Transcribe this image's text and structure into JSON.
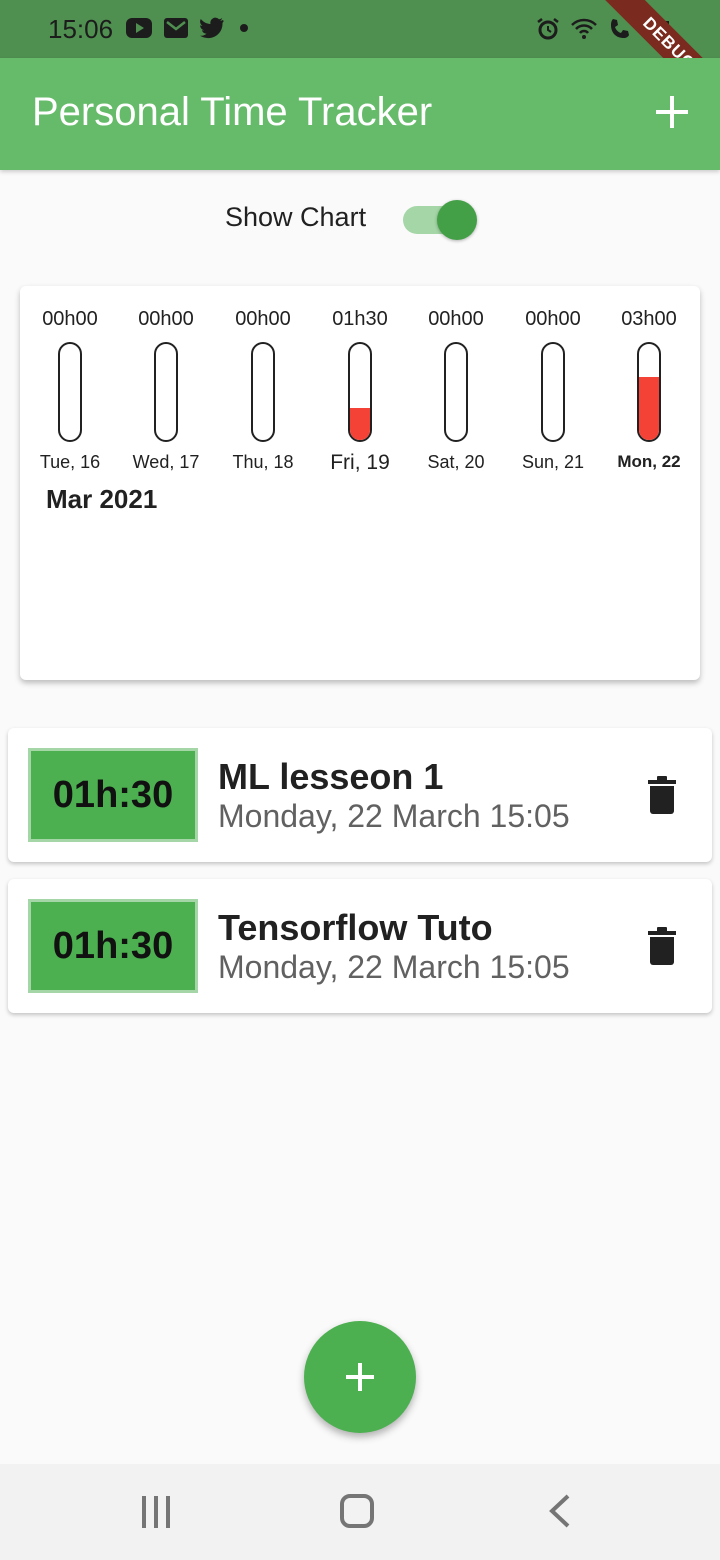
{
  "status_bar": {
    "time": "15:06",
    "left_icons": [
      "youtube-icon",
      "mail-icon",
      "twitter-icon",
      "dot-icon"
    ],
    "right_icons": [
      "alarm-icon",
      "wifi-icon",
      "call-icon",
      "signal-icon"
    ],
    "debug_banner": "DEBUG",
    "color": "#4f8f50"
  },
  "app_bar": {
    "title": "Personal Time Tracker",
    "action_icon": "add-icon",
    "color": "#66bb6a"
  },
  "toggle": {
    "label": "Show Chart",
    "checked": true,
    "thumb_color": "#43a047"
  },
  "chart": {
    "month_label": "Mar 2021",
    "fill_color": "#f44336",
    "days": [
      {
        "label": "Tue, 16",
        "value": "00h00",
        "fill": 0
      },
      {
        "label": "Wed, 17",
        "value": "00h00",
        "fill": 0
      },
      {
        "label": "Thu, 18",
        "value": "00h00",
        "fill": 0
      },
      {
        "label": "Fri, 19",
        "value": "01h30",
        "fill": 0.33
      },
      {
        "label": "Sat, 20",
        "value": "00h00",
        "fill": 0
      },
      {
        "label": "Sun, 21",
        "value": "00h00",
        "fill": 0
      },
      {
        "label": "Mon, 22",
        "value": "03h00",
        "fill": 0.66
      }
    ]
  },
  "entries": [
    {
      "duration": "01h:30",
      "title": "ML lesseon 1",
      "date": "Monday, 22 March 15:05",
      "action_icon": "trash-icon"
    },
    {
      "duration": "01h:30",
      "title": "Tensorflow Tuto",
      "date": "Monday, 22 March 15:05",
      "action_icon": "trash-icon"
    }
  ],
  "fab": {
    "icon": "add-icon",
    "color": "#4caf50"
  },
  "nav_bar": {
    "icons": [
      "recents-icon",
      "home-icon",
      "back-icon"
    ]
  }
}
